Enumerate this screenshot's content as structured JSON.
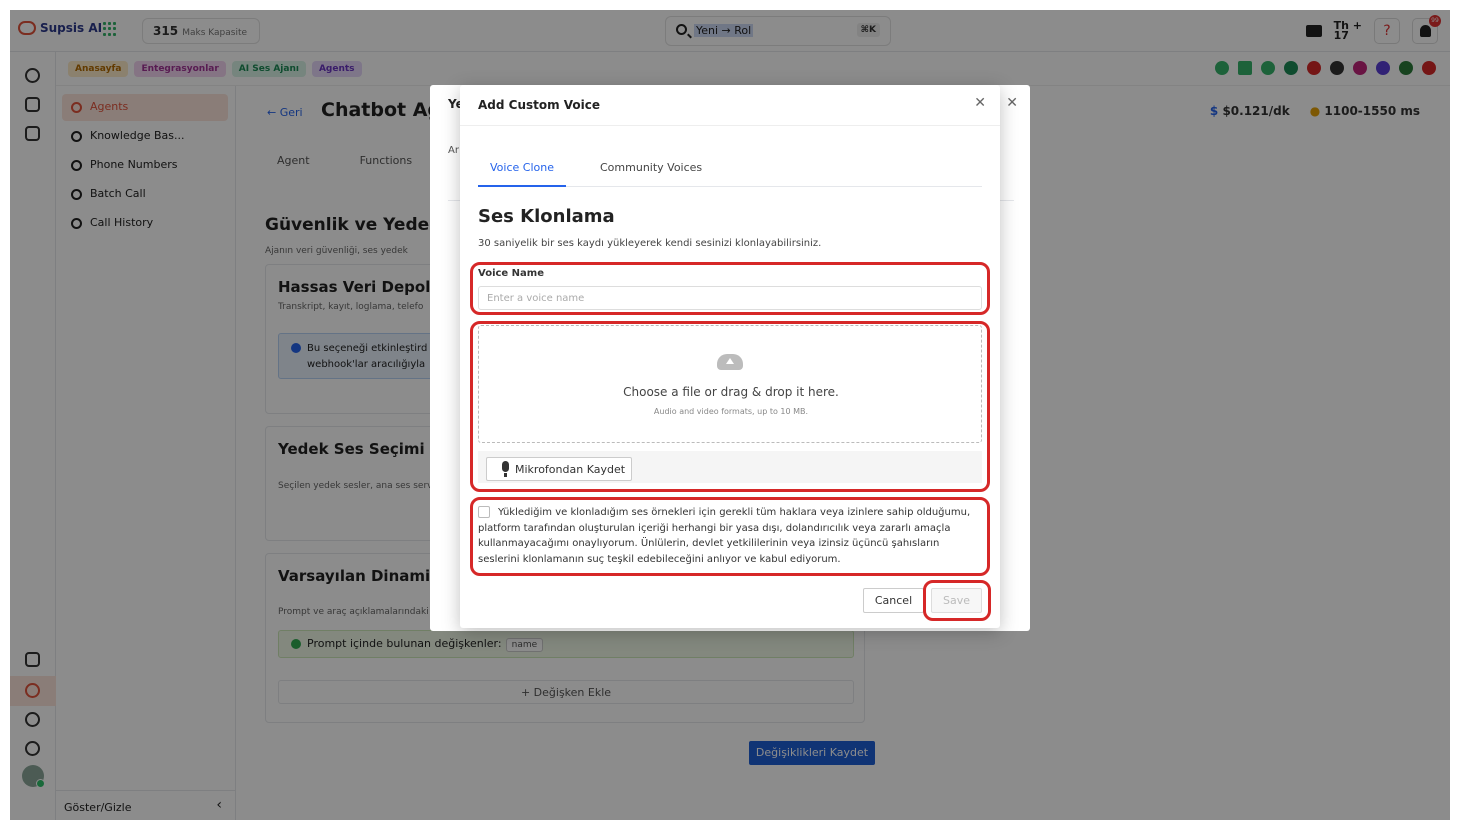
{
  "topbar": {
    "logo": "Supsis AI",
    "capacity_value": "315",
    "capacity_label": "Maks Kapasite",
    "search_text": "Yeni → Rol",
    "search_kbd": "⌘K",
    "th_label": "Th",
    "th_num": "17",
    "help_glyph": "?",
    "notif_count": "99"
  },
  "crumbs": [
    "Anasayfa",
    "Entegrasyonlar",
    "AI Ses Ajanı",
    "Agents"
  ],
  "sidebar": {
    "items": [
      {
        "label": "Agents",
        "icon": "robot-icon"
      },
      {
        "label": "Knowledge Bas...",
        "icon": "knowledge-icon"
      },
      {
        "label": "Phone Numbers",
        "icon": "phone-icon"
      },
      {
        "label": "Batch Call",
        "icon": "phone-icon"
      },
      {
        "label": "Call History",
        "icon": "history-icon"
      }
    ],
    "footer": "Göster/Gizle"
  },
  "main": {
    "back": "Geri",
    "title": "Chatbot Age",
    "tabs": [
      "Agent",
      "Functions"
    ],
    "cost": "$0.121/dk",
    "latency": "1100-1550 ms",
    "section1_title": "Güvenlik ve Yedek",
    "section1_sub": "Ajanın veri güvenliği, ses yedek",
    "card1_title": "Hassas Veri Depola",
    "card1_sub": "Transkript, kayıt, loglama, telefo",
    "card1_info_line1": "Bu seçeneği etkinleştird",
    "card1_info_line2": "webhook'lar aracılığıyla",
    "card2_title": "Yedek Ses Seçimi",
    "card2_sub": "Seçilen yedek sesler, ana ses servi",
    "card3_title": "Varsayılan Dinamik",
    "card3_sub": "Prompt ve araç açıklamalarındaki",
    "var_label": "Prompt içinde bulunan değişkenler:",
    "var_chip": "name",
    "add_var": "+ Değişken Ekle",
    "save_changes": "Değişiklikleri Kaydet"
  },
  "back_modal": {
    "title_fragment": "Ye",
    "tab_fragment": "Ar"
  },
  "modal": {
    "title": "Add Custom Voice",
    "tabs": [
      "Voice Clone",
      "Community Voices"
    ],
    "heading": "Ses Klonlama",
    "description": "30 saniyelik bir ses kaydı yükleyerek kendi sesinizi klonlayabilirsiniz.",
    "voice_name_label": "Voice Name",
    "voice_name_placeholder": "Enter a voice name",
    "voice_name_value": "",
    "dropzone_main": "Choose a file or drag & drop it here.",
    "dropzone_sub": "Audio and video formats, up to 10 MB.",
    "record_button": "Mikrofondan Kaydet",
    "consent_text": "Yüklediğim ve klonladığım ses örnekleri için gerekli tüm haklara veya izinlere sahip olduğumu, platform tarafından oluşturulan içeriği herhangi bir yasa dışı, dolandırıcılık veya zararlı amaçla kullanmayacağımı onaylıyorum. Ünlülerin, devlet yetkililerinin veya izinsiz üçüncü şahısların seslerini klonlamanın suç teşkil edebileceğini anlıyor ve kabul ediyorum.",
    "consent_checked": false,
    "cancel_button": "Cancel",
    "save_button": "Save"
  },
  "colors": {
    "accent": "#2563eb",
    "brand": "#e0533b",
    "highlight": "#d62828"
  }
}
